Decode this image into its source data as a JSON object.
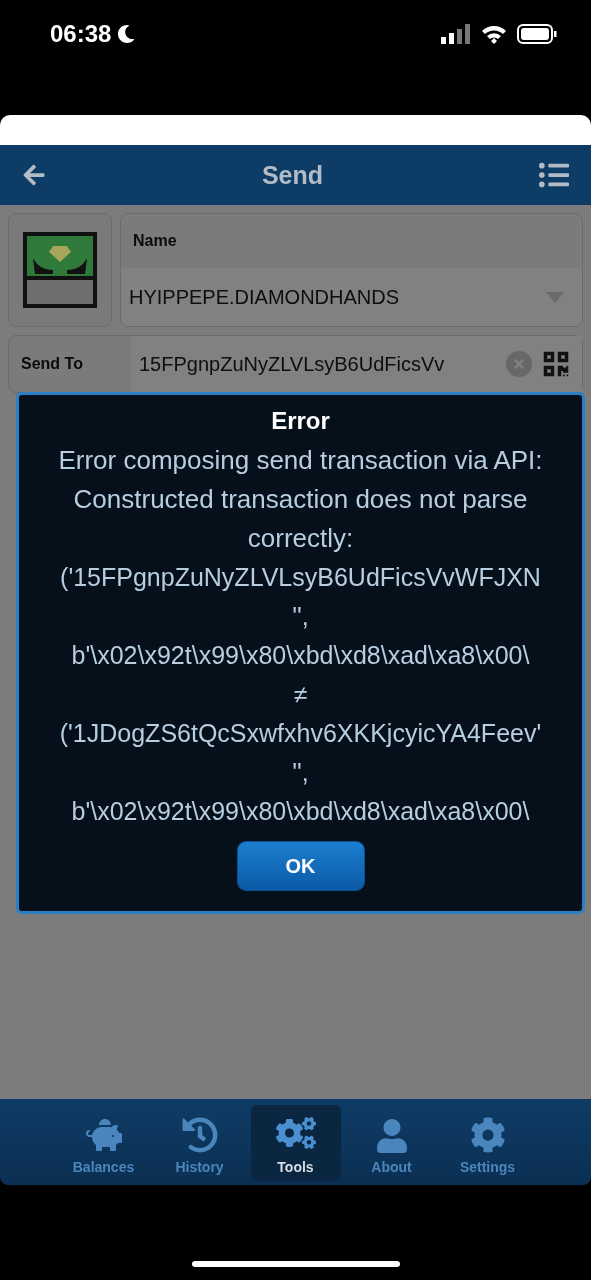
{
  "status_bar": {
    "time": "06:38"
  },
  "header": {
    "title": "Send"
  },
  "form": {
    "token": {
      "label": "Name",
      "value": "HYIPPEPE.DIAMONDHANDS"
    },
    "send_to": {
      "label": "Send To",
      "value": "15FPgnpZuNyZLVLsyB6UdFicsVv"
    }
  },
  "dialog": {
    "title": "Error",
    "message": "Error composing send transaction via API: Constructed transaction does not parse correctly:",
    "lines": [
      "('15FPgnpZuNyZLVLsyB6UdFicsVvWFJXN",
      "'',",
      "b'\\x02\\x92t\\x99\\x80\\xbd\\xd8\\xad\\xa8\\x00\\",
      "≠",
      "('1JDogZS6tQcSxwfxhv6XKKjcyicYA4Feev'",
      "'',",
      "b'\\x02\\x92t\\x99\\x80\\xbd\\xd8\\xad\\xa8\\x00\\"
    ],
    "button": "OK"
  },
  "tabs": [
    {
      "label": "Balances",
      "selected": false
    },
    {
      "label": "History",
      "selected": false
    },
    {
      "label": "Tools",
      "selected": true
    },
    {
      "label": "About",
      "selected": false
    },
    {
      "label": "Settings",
      "selected": false
    }
  ]
}
